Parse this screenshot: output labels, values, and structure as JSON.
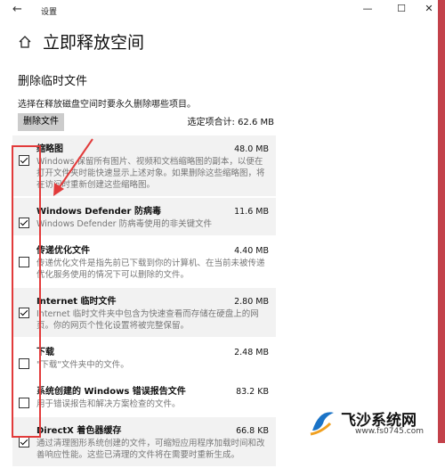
{
  "window": {
    "title": "设置",
    "back": "←",
    "minimize": "—",
    "maximize": "☐",
    "close": "✕"
  },
  "header": {
    "title": "立即释放空间"
  },
  "section": {
    "title": "删除临时文件",
    "description": "选择在释放磁盘空间时要永久删除哪些项目。",
    "delete_button": "删除文件",
    "total_label": "选定项合计: 62.6 MB"
  },
  "items": [
    {
      "name": "缩略图",
      "size": "48.0 MB",
      "checked": true,
      "shaded": true,
      "lines": [
        "Windows 保留所有图片、视频和文档缩略图的副本，以便在",
        "打开文件夹时能快速显示上述对象。如果删除这些缩略图，将",
        "在访问时重新创建这些缩略图。"
      ]
    },
    {
      "name": "Windows Defender 防病毒",
      "size": "11.6 MB",
      "checked": true,
      "shaded": true,
      "lines": [
        "Windows Defender 防病毒使用的非关键文件"
      ]
    },
    {
      "name": "传递优化文件",
      "size": "4.40 MB",
      "checked": false,
      "shaded": false,
      "lines": [
        "传递优化文件是指先前已下载到你的计算机、在当前未被传递",
        "优化服务使用的情况下可以删除的文件。"
      ]
    },
    {
      "name": "Internet 临时文件",
      "size": "2.80 MB",
      "checked": true,
      "shaded": true,
      "lines": [
        "Internet 临时文件夹中包含为快速查看而存储在硬盘上的网",
        "页。你的网页个性化设置将被完整保留。"
      ]
    },
    {
      "name": "下载",
      "size": "2.48 MB",
      "checked": false,
      "shaded": false,
      "lines": [
        "\"下载\"文件夹中的文件。"
      ]
    },
    {
      "name": "系统创建的 Windows 错误报告文件",
      "size": "83.2 KB",
      "checked": false,
      "shaded": false,
      "lines": [
        "用于错误报告和解决方案检查的文件。"
      ]
    },
    {
      "name": "DirectX 着色器缓存",
      "size": "66.8 KB",
      "checked": true,
      "shaded": true,
      "lines": [
        "通过清理图形系统创建的文件，可缩短应用程序加载时间和改",
        "善响应性能。这些已清理的文件将在需要时重新生成。"
      ]
    }
  ],
  "watermark": {
    "text": "飞沙系统网",
    "url": "www.fs0745.com"
  },
  "colors": {
    "annotation": "#e23b3b",
    "accent_strip": "#c3414a",
    "shaded_row": "#f2f2f2",
    "button": "#cccccc"
  }
}
